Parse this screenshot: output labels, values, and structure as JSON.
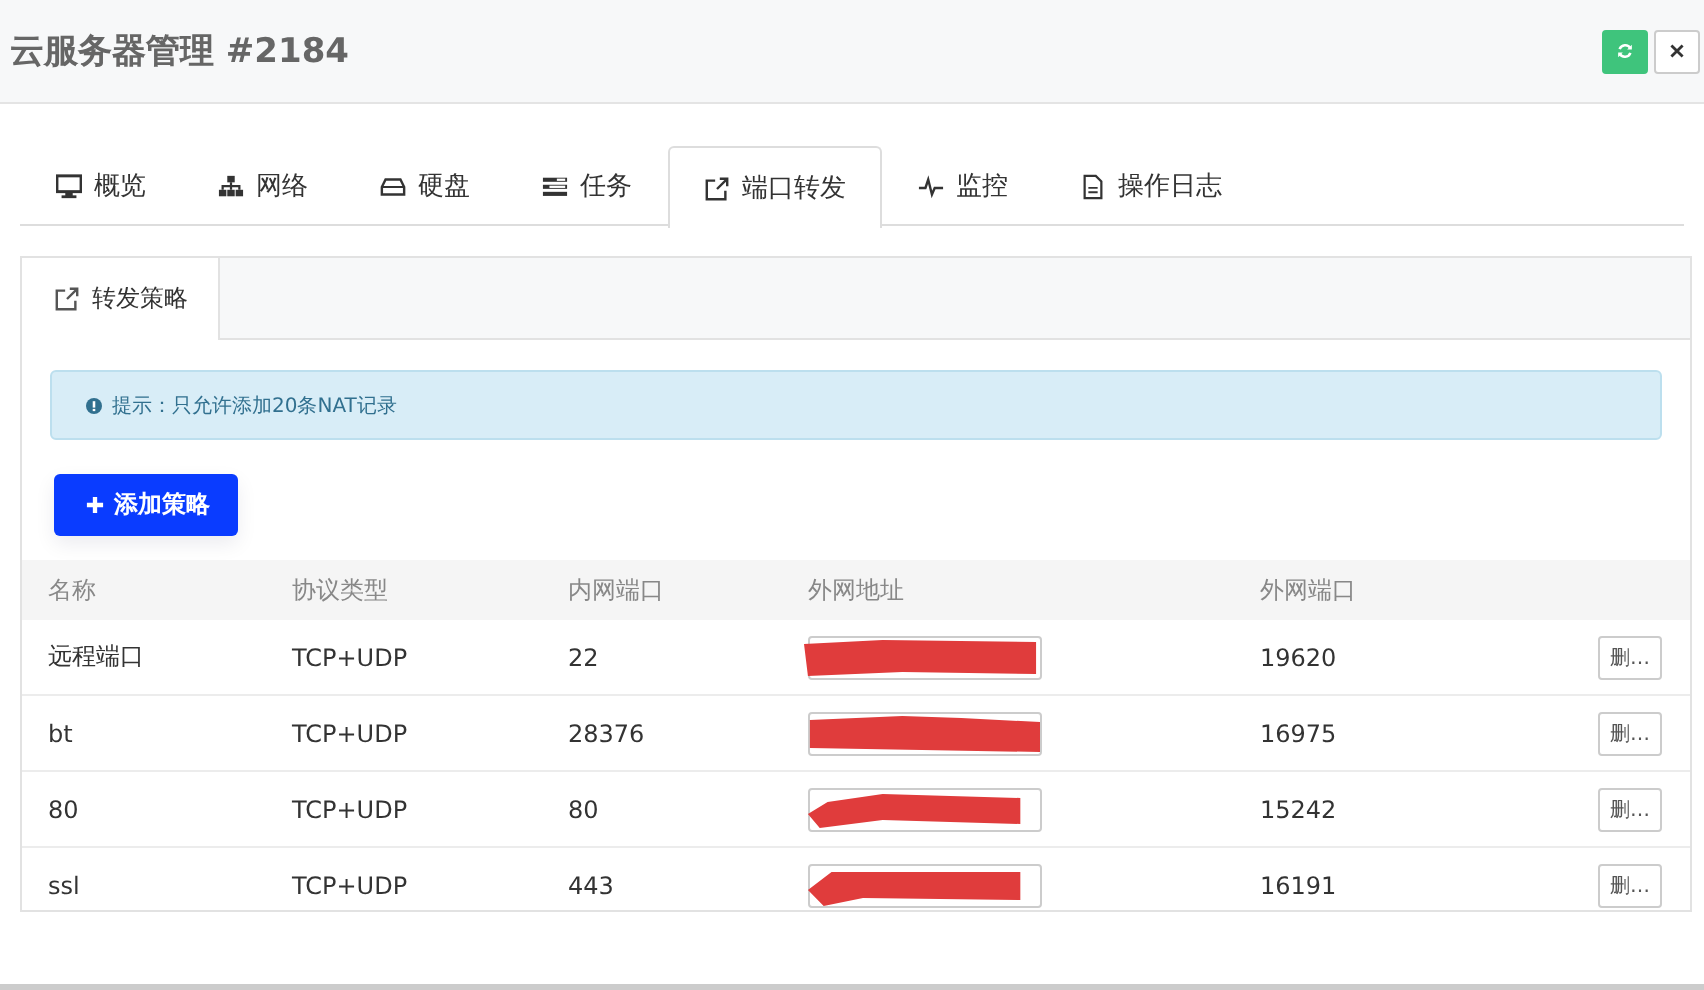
{
  "window": {
    "title": "云服务器管理 #2184"
  },
  "header_buttons": [
    {
      "kind": "refresh"
    },
    {
      "kind": "close"
    }
  ],
  "tabs": [
    {
      "label": "概览",
      "kind": "monitor",
      "selected": false
    },
    {
      "label": "网络",
      "kind": "sitemap",
      "selected": false
    },
    {
      "label": "硬盘",
      "kind": "disk",
      "selected": false
    },
    {
      "label": "任务",
      "kind": "tasks",
      "selected": false
    },
    {
      "label": "端口转发",
      "kind": "external",
      "selected": true
    },
    {
      "label": "监控",
      "kind": "pulse",
      "selected": false
    },
    {
      "label": "操作日志",
      "kind": "file",
      "selected": false
    }
  ],
  "sub_tabs": [
    {
      "label": "转发策略",
      "selected": true
    }
  ],
  "alert": {
    "text": "提示：只允许添加20条NAT记录"
  },
  "add_button": {
    "label": "添加策略"
  },
  "table": {
    "columns": [
      "名称",
      "协议类型",
      "内网端口",
      "外网地址",
      "外网端口"
    ],
    "rows": [
      {
        "name": "远程端口",
        "protocol": "TCP+UDP",
        "inner_port": "22",
        "address_redacted": true,
        "outer_port": "19620",
        "action": "删…"
      },
      {
        "name": "bt",
        "protocol": "TCP+UDP",
        "inner_port": "28376",
        "address_redacted": true,
        "outer_port": "16975",
        "action": "删…"
      },
      {
        "name": "80",
        "protocol": "TCP+UDP",
        "inner_port": "80",
        "address_redacted": true,
        "outer_port": "15242",
        "action": "删…"
      },
      {
        "name": "ssl",
        "protocol": "TCP+UDP",
        "inner_port": "443",
        "address_redacted": true,
        "outer_port": "16191",
        "action": "删…"
      }
    ]
  }
}
